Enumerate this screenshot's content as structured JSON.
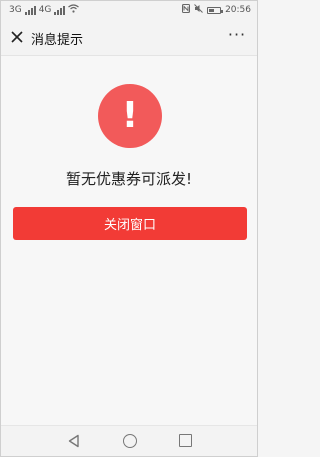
{
  "status_bar": {
    "sim1": "3G",
    "sim2": "4G",
    "time": "20:56"
  },
  "header": {
    "close_icon": "close-icon",
    "title": "消息提示",
    "more_icon": "more-icon",
    "more_label": "···"
  },
  "main": {
    "alert_icon": "exclamation-icon",
    "alert_symbol": "!",
    "message": "暂无优惠券可派发!",
    "button_label": "关闭窗口",
    "accent_color": "#f23b36",
    "alert_color": "#f25a5a"
  },
  "nav": {
    "back_icon": "back-icon",
    "home_icon": "home-icon",
    "recent_icon": "recent-apps-icon"
  }
}
